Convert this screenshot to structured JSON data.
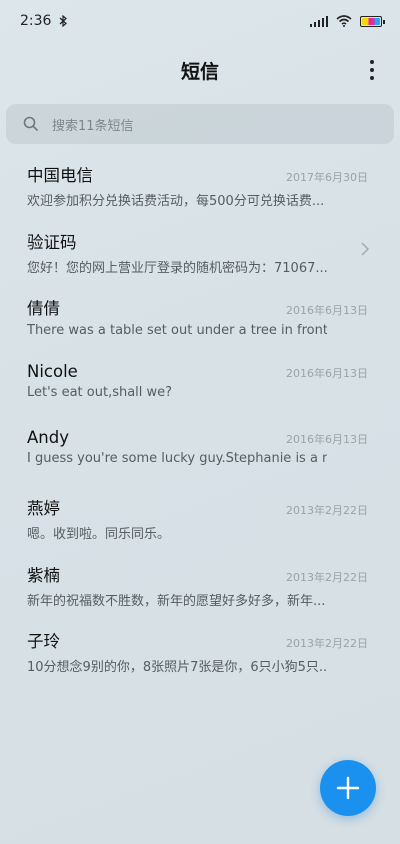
{
  "status_bar": {
    "time": "2:36",
    "icons": [
      "bluetooth-icon",
      "signal-icon",
      "wifi-icon",
      "battery-icon"
    ],
    "battery_colors": [
      "#f5d70a",
      "#e7289c",
      "#2aa3f0"
    ]
  },
  "header": {
    "title": "短信",
    "more_icon": "more-vertical-icon"
  },
  "search": {
    "placeholder": "搜索11条短信",
    "icon": "search-icon"
  },
  "conversations": [
    {
      "name": "中国电信",
      "date": "2017年6月30日",
      "preview": "欢迎参加积分兑换话费活动，每500分可兑换话费..."
    },
    {
      "name": "验证码",
      "date": "",
      "preview": "您好！您的网上营业厅登录的随机密码为：71067...",
      "has_chevron": true
    },
    {
      "name": "倩倩",
      "date": "2016年6月13日",
      "preview": "There was a table set out under a tree in front o..."
    },
    {
      "name": "Nicole",
      "date": "2016年6月13日",
      "preview": "Let's eat out,shall we?"
    },
    {
      "name": "Andy",
      "date": "2016年6月13日",
      "preview": "I guess you're some lucky guy.Stephanie is a n..."
    },
    {
      "name": "燕婷",
      "date": "2013年2月22日",
      "preview": "嗯。收到啦。同乐同乐。"
    },
    {
      "name": "紫楠",
      "date": "2013年2月22日",
      "preview": "新年的祝福数不胜数，新年的愿望好多好多，新年..."
    },
    {
      "name": "子玲",
      "date": "2013年2月22日",
      "preview": "10分想念9别的你，8张照片7张是你，6只小狗5只..."
    }
  ],
  "fab": {
    "icon": "plus-icon",
    "color": "#1a91ee"
  },
  "colors": {
    "accent": "#1a91ee",
    "background": "#dbe4e9"
  }
}
